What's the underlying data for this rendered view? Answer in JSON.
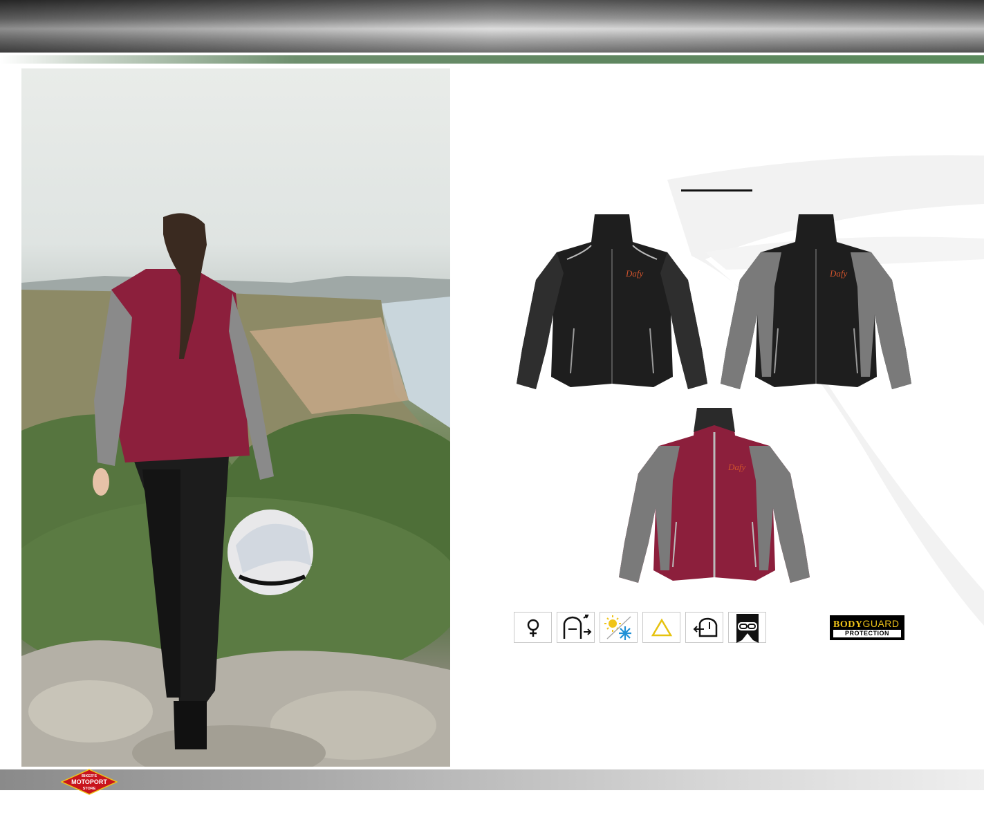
{
  "colors": {
    "accent_green": "#5f8660",
    "jacket_red": "#8c1f3c",
    "jacket_grey": "#8a8a8a",
    "jacket_black": "#1e1e1e",
    "icon_blue": "#1e90d6",
    "icon_yellow": "#f0c419"
  },
  "images": {
    "lifestyle_photo": "woman-walking-coast-photo",
    "product_1": "black-jacket-front",
    "product_2": "black-grey-jacket-front",
    "product_3": "red-grey-jacket-front"
  },
  "features": [
    {
      "icon": "female-symbol-icon"
    },
    {
      "icon": "adjustable-collar-icon"
    },
    {
      "icon": "sun-snow-season-icon"
    },
    {
      "icon": "reflective-triangle-icon"
    },
    {
      "icon": "connection-zip-icon"
    },
    {
      "icon": "waist-connection-icon"
    }
  ],
  "badge": {
    "line1_a": "BODY",
    "line1_b": "GUARD",
    "line2": "PROTECTION"
  },
  "footer": {
    "logo_line1": "BIKER'S",
    "logo_line2": "MOTOPORT",
    "logo_line3": "STORE"
  }
}
